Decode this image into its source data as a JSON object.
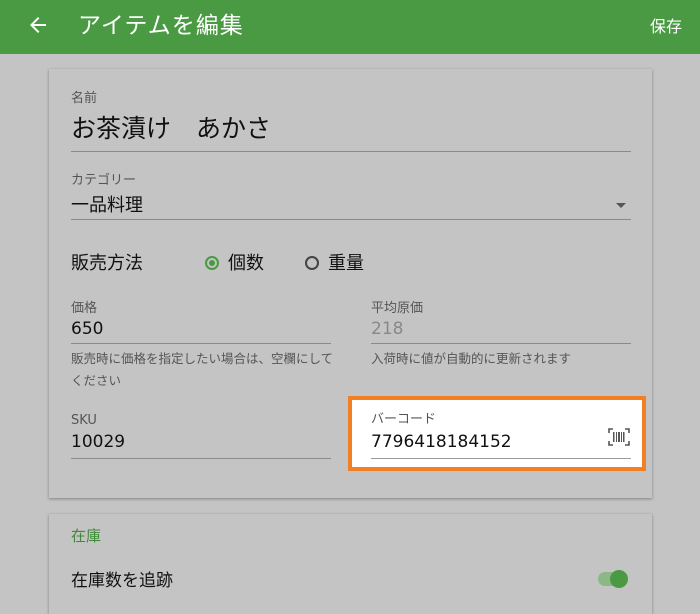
{
  "appbar": {
    "title": "アイテムを編集",
    "save_label": "保存",
    "back_icon": "arrow-left-icon"
  },
  "form": {
    "name": {
      "label": "名前",
      "value": "お茶漬け　あかさ"
    },
    "category": {
      "label": "カテゴリー",
      "value": "一品料理"
    },
    "sale_method": {
      "label": "販売方法",
      "option_count": "個数",
      "option_weight": "重量",
      "selected": "個数"
    },
    "price": {
      "label": "価格",
      "value": "650",
      "help": "販売時に価格を指定したい場合は、空欄にしてください"
    },
    "avg_cost": {
      "label": "平均原価",
      "placeholder": "218",
      "help": "入荷時に値が自動的に更新されます"
    },
    "sku": {
      "label": "SKU",
      "value": "10029"
    },
    "barcode": {
      "label": "バーコード",
      "value": "7796418184152",
      "scan_icon": "barcode-scan-icon"
    }
  },
  "inventory": {
    "section_title": "在庫",
    "track_label": "在庫数を追跡",
    "track_enabled": true
  },
  "colors": {
    "accent": "#4a9a43",
    "highlight": "#f07f26",
    "background": "#c4c4c4"
  }
}
